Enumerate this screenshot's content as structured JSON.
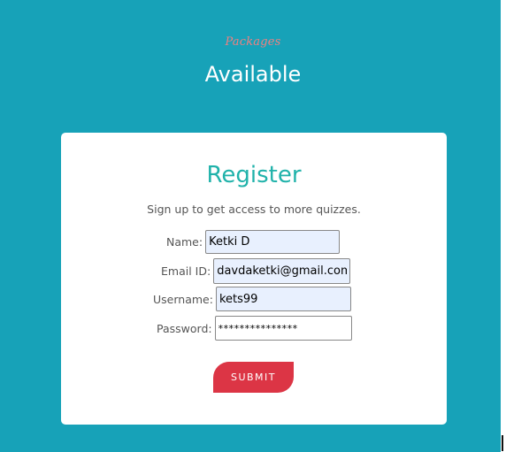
{
  "header": {
    "script_label": "Packages",
    "title": "Available"
  },
  "register": {
    "title": "Register",
    "subtitle": "Sign up to get access to more quizzes.",
    "fields": {
      "name": {
        "label": "Name:",
        "value": "Ketki D"
      },
      "email": {
        "label": "Email ID:",
        "value": "davdaketki@gmail.com"
      },
      "username": {
        "label": "Username:",
        "value": "kets99"
      },
      "password": {
        "label": "Password:",
        "value": "***************"
      }
    },
    "submit_label": "SUBMIT"
  },
  "colors": {
    "background": "#17a2b8",
    "accent_title": "#20b2aa",
    "script_label": "#f08080",
    "submit": "#dc3545",
    "autofill": "#e8f0fe"
  }
}
